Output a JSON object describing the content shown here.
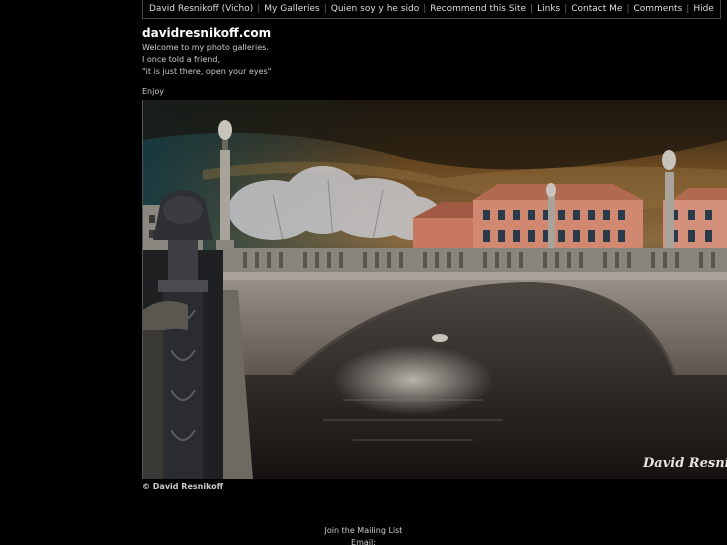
{
  "nav": {
    "items": [
      {
        "label": "David Resnikoff (Vicho)"
      },
      {
        "label": "My Galleries"
      },
      {
        "label": "Quien soy y he sido"
      },
      {
        "label": "Recommend this Site"
      },
      {
        "label": "Links"
      },
      {
        "label": "Contact Me"
      },
      {
        "label": "Comments"
      },
      {
        "label": "Hide"
      }
    ],
    "separator": "|"
  },
  "site": {
    "title": "davidresnikoff.com",
    "intro_lines": [
      "Welcome to my photo galleries.",
      "I once told a friend,",
      "\"it is just there, open your eyes\""
    ],
    "enjoy": "Enjoy"
  },
  "photo": {
    "signature": "David Resnik",
    "copyright": "© David Resnikoff"
  },
  "mailing": {
    "join_label": "Join the Mailing List",
    "email_label": "Email:"
  }
}
